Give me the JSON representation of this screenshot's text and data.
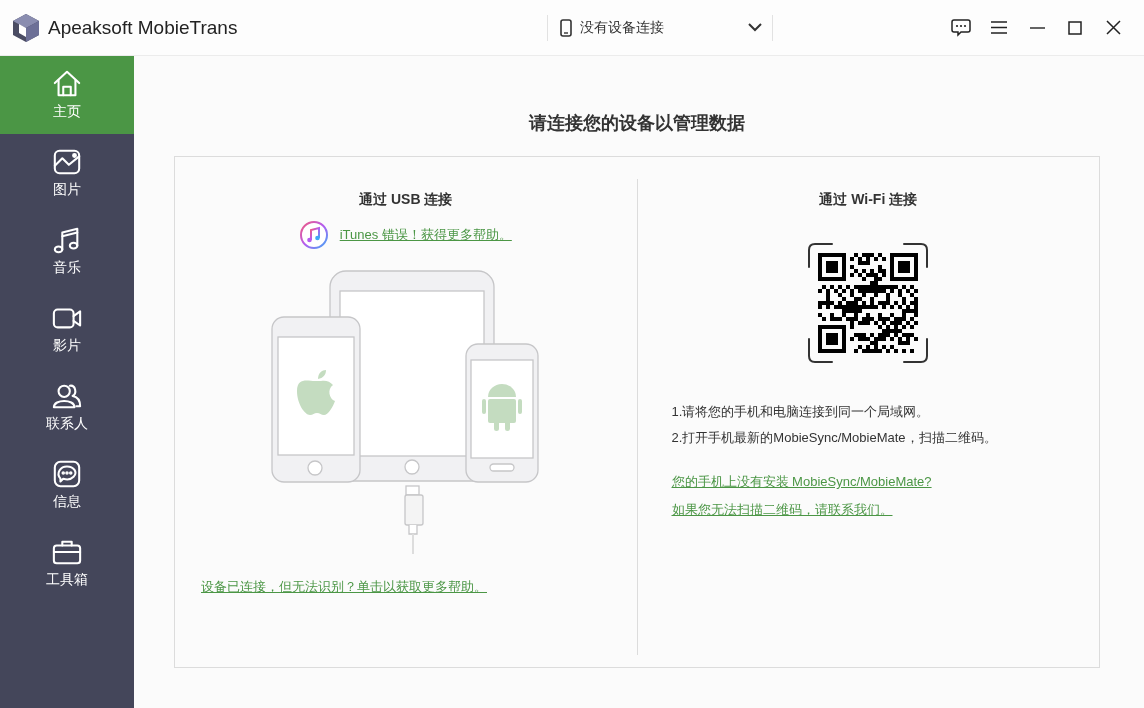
{
  "window": {
    "title": "Apeaksoft MobieTrans"
  },
  "device_selector": {
    "value": "没有设备连接"
  },
  "sidebar": {
    "items": [
      {
        "label": "主页",
        "kind": "home",
        "selected": true
      },
      {
        "label": "图片",
        "kind": "picture",
        "selected": false
      },
      {
        "label": "音乐",
        "kind": "music",
        "selected": false
      },
      {
        "label": "影片",
        "kind": "video",
        "selected": false
      },
      {
        "label": "联系人",
        "kind": "contacts",
        "selected": false
      },
      {
        "label": "信息",
        "kind": "message",
        "selected": false
      },
      {
        "label": "工具箱",
        "kind": "toolbox",
        "selected": false
      }
    ]
  },
  "main": {
    "heading": "请连接您的设备以管理数据",
    "usb": {
      "title": "通过 USB 连接",
      "itunes_link": "iTunes 错误！获得更多帮助。",
      "help_link": "设备已连接，但无法识别？单击以获取更多帮助。"
    },
    "wifi": {
      "title": "通过 Wi-Fi 连接",
      "steps": [
        "1.请将您的手机和电脑连接到同一个局域网。",
        "2.打开手机最新的MobieSync/MobieMate，扫描二维码。"
      ],
      "links": [
        "您的手机上没有安装 MobieSync/MobieMate? ",
        "如果您无法扫描二维码，请联系我们。"
      ]
    }
  }
}
